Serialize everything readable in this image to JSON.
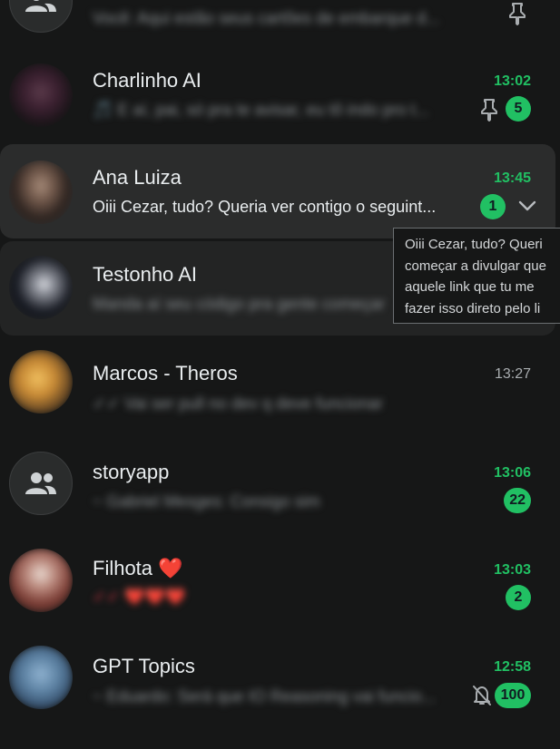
{
  "colors": {
    "accent_green": "#21c063",
    "background": "#161717",
    "highlight_row": "#2b2c2c"
  },
  "chats": [
    {
      "name": "",
      "time": "",
      "preview": "Você: Aqui estão seus cartões de embarque d...",
      "pinned": true
    },
    {
      "name": "Charlinho AI",
      "time": "13:02",
      "preview": "🎵 E aí, pai, só pra te avisar, eu tô indo pro t...",
      "unread": "5",
      "pinned": true
    },
    {
      "name": "Ana Luiza",
      "time": "13:45",
      "preview": "Oiii Cezar, tudo? Queria ver contigo o seguint...",
      "unread": "1"
    },
    {
      "name": "Testonho AI",
      "time": "",
      "preview": "Manda aí seu código pra gente começar"
    },
    {
      "name": "Marcos - Theros",
      "time": "13:27",
      "preview": "✓✓ Vai ser pull no dev q deve funcionar"
    },
    {
      "name": "storyapp",
      "time": "13:06",
      "preview": "~ Gabriel Mesges: Consigo sim",
      "unread": "22"
    },
    {
      "name": "Filhota ❤️",
      "time": "13:03",
      "preview": "✓✓ ❤️❤️❤️",
      "unread": "2"
    },
    {
      "name": "GPT Topics",
      "time": "12:58",
      "preview": "~ Eduardo: Será que IO Reasoning vai funcio...",
      "unread": "100",
      "muted": true
    }
  ],
  "tooltip": {
    "lines": [
      "Oiii Cezar, tudo? Queri",
      "começar a divulgar que",
      "aquele link que tu me",
      "fazer isso direto pelo li"
    ]
  },
  "icons": {
    "pin": "pin-icon",
    "chevron": "chevron-down-icon",
    "muted": "bell-off-icon",
    "group": "group-icon"
  }
}
